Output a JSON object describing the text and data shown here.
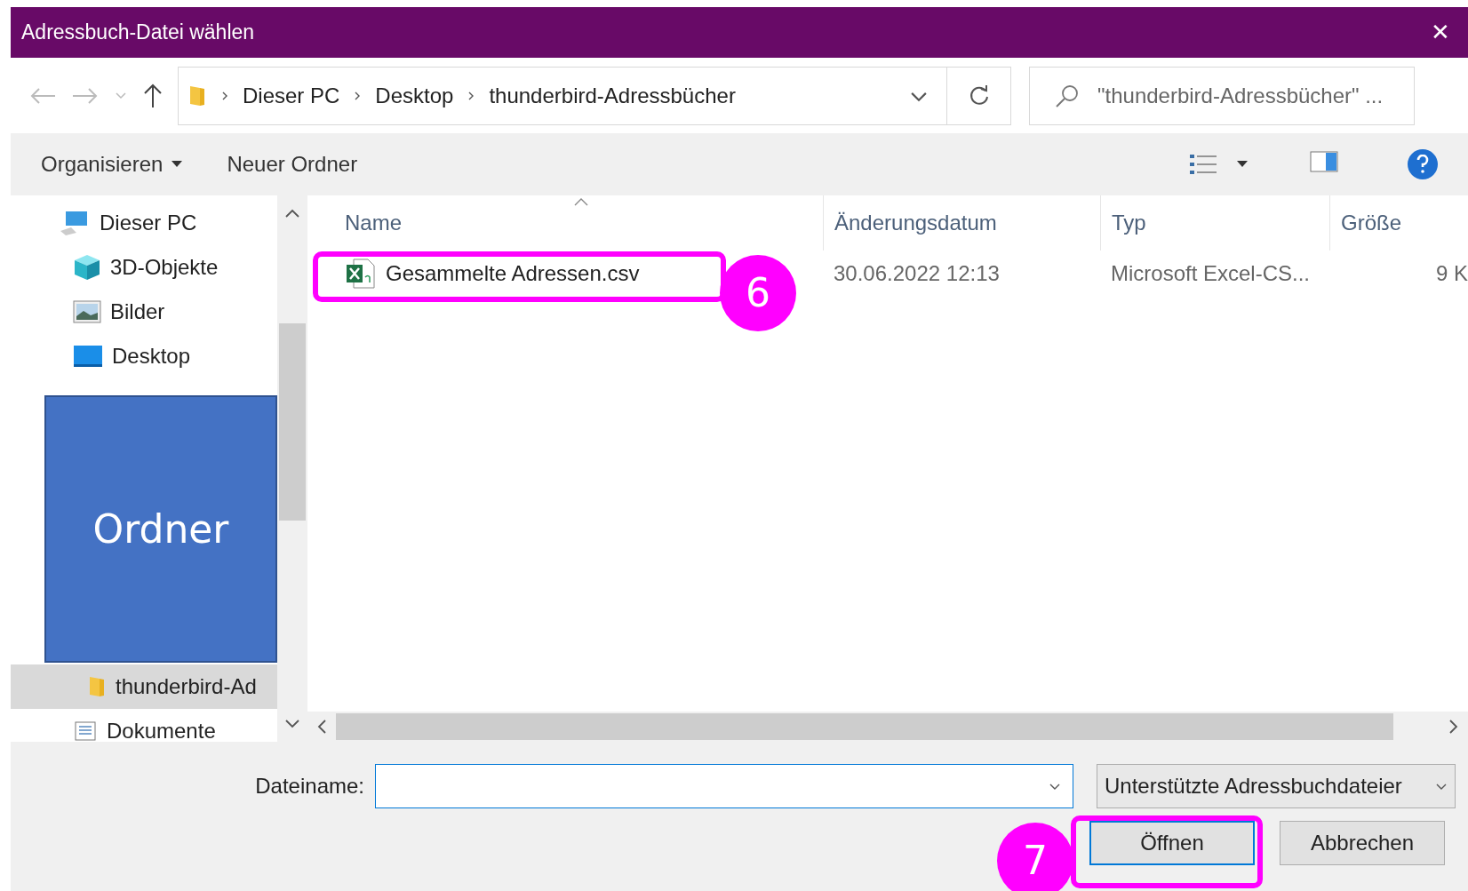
{
  "window": {
    "title": "Adressbuch-Datei wählen",
    "close": "✕"
  },
  "address_bar": {
    "breadcrumbs": [
      "Dieser PC",
      "Desktop",
      "thunderbird-Adressbücher"
    ]
  },
  "search": {
    "placeholder": "\"thunderbird-Adressbücher\" ..."
  },
  "toolbar": {
    "organize": "Organisieren",
    "new_folder": "Neuer Ordner"
  },
  "nav_pane": {
    "items": [
      {
        "label": "Dieser PC",
        "kind": "pc",
        "selected": false,
        "children": [
          {
            "label": "3D-Objekte",
            "kind": "cube",
            "selected": false
          },
          {
            "label": "Bilder",
            "kind": "pictures",
            "selected": false
          },
          {
            "label": "Desktop",
            "kind": "desktop",
            "selected": false,
            "children": [
              {
                "label": "thunderbird-Ad",
                "kind": "folder",
                "selected": true
              }
            ]
          },
          {
            "label": "Dokumente",
            "kind": "documents",
            "selected": false
          }
        ]
      }
    ]
  },
  "table": {
    "columns": [
      "Name",
      "Änderungsdatum",
      "Typ",
      "Größe"
    ],
    "rows": [
      {
        "name": "Gesammelte Adressen.csv",
        "date": "30.06.2022 12:13",
        "type": "Microsoft Excel-CS...",
        "size": "9 K"
      }
    ]
  },
  "file_name": {
    "label": "Dateiname:"
  },
  "file_type": {
    "value": "Unterstützte Adressbuchdateier"
  },
  "buttons": [
    {
      "label": "Öffnen",
      "default": true
    },
    {
      "label": "Abbrechen",
      "default": false
    }
  ],
  "overlay": {
    "label": "Ordner"
  },
  "annotations": [
    {
      "label": "6"
    },
    {
      "label": "7"
    }
  ]
}
